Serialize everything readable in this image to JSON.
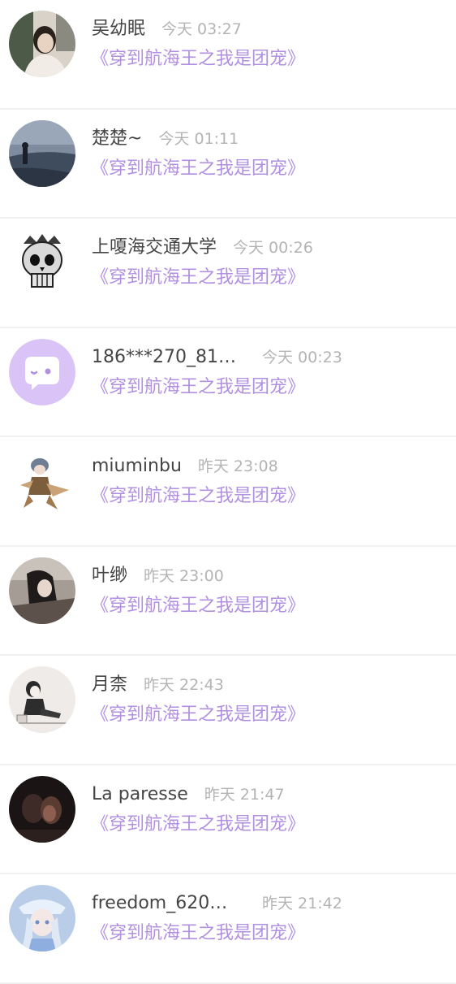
{
  "rows": [
    {
      "name": "吴幼眠",
      "time": "今天 03:27",
      "book": "《穿到航海王之我是团宠》",
      "avatar_icon": "user-photo-avatar"
    },
    {
      "name": "楚楚~",
      "time": "今天 01:11",
      "book": "《穿到航海王之我是团宠》",
      "avatar_icon": "seaside-photo-avatar"
    },
    {
      "name": "上嗄海交通大学",
      "time": "今天 00:26",
      "book": "《穿到航海王之我是团宠》",
      "avatar_icon": "skull-avatar"
    },
    {
      "name": "186***270_81…",
      "time": "今天 00:23",
      "book": "《穿到航海王之我是团宠》",
      "avatar_icon": "default-chat-avatar"
    },
    {
      "name": "miuminbu",
      "time": "昨天 23:08",
      "book": "《穿到航海王之我是团宠》",
      "avatar_icon": "anime-figure-avatar"
    },
    {
      "name": "叶缈",
      "time": "昨天 23:00",
      "book": "《穿到航海王之我是团宠》",
      "avatar_icon": "dark-photo-avatar"
    },
    {
      "name": "月柰",
      "time": "昨天 22:43",
      "book": "《穿到航海王之我是团宠》",
      "avatar_icon": "sketch-girl-avatar"
    },
    {
      "name": "La paresse",
      "time": "昨天 21:47",
      "book": "《穿到航海王之我是团宠》",
      "avatar_icon": "couple-photo-avatar"
    },
    {
      "name": "freedom_620…",
      "time": "昨天 21:42",
      "book": "《穿到航海王之我是团宠》",
      "avatar_icon": "anime-girl-avatar"
    }
  ],
  "colors": {
    "book_title": "#b190df",
    "name": "#454545",
    "time": "#b4b4b4",
    "default_avatar_bg": "#d9c3f7",
    "divider": "#f1f1f1"
  }
}
